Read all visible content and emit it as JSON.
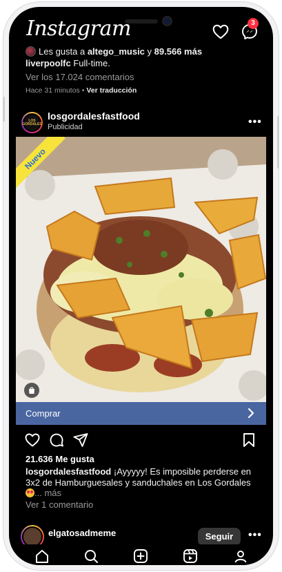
{
  "app": {
    "logo_text": "Instagram"
  },
  "header": {
    "messages_badge": "3",
    "icons": [
      "heart-icon",
      "messenger-icon"
    ]
  },
  "previous_post": {
    "likes_prefix": "Les gusta a ",
    "liked_by": "altego_music",
    "likes_connector": " y ",
    "likes_others": "89.566 más",
    "caption_user": "liverpoolfc",
    "caption_text": " Full-time.",
    "view_comments": "Ver los 17.024 comentarios",
    "time": "Hace 31 minutos",
    "separator": " • ",
    "translate": "Ver traducción"
  },
  "post": {
    "username": "losgordalesfastfood",
    "sponsored": "Publicidad",
    "avatar_text": "LOS GORDALES",
    "ribbon": "Nuevo",
    "buy_label": "Comprar",
    "likes": "21.636 Me gusta",
    "caption_user": "losgordalesfastfood",
    "caption_text": " ¡Ayyyyy! Es imposible perderse en 3x2 de Hamburguesales y sanduchales en Los Gordales ",
    "caption_more": "... más",
    "view_comments": "Ver 1 comentario"
  },
  "next_post": {
    "username": "elgatosadmeme",
    "follow_label": "Seguir"
  },
  "colors": {
    "background": "#000000",
    "buy_bar": "#4a66a1",
    "badge": "#ff3040",
    "ribbon": "#f7e33a"
  }
}
